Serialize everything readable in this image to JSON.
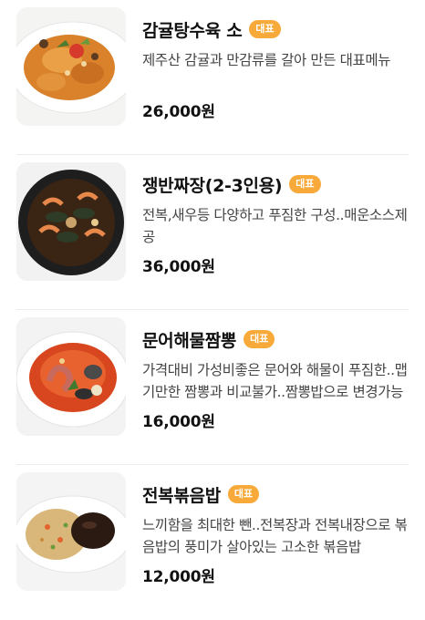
{
  "menu_items": [
    {
      "name": "감귤탕수육 소",
      "badge": "대표",
      "description": "제주산 감귤과 만감류를 갈아 만든 대표메뉴",
      "price": "26,000원",
      "image": "tangsuyuk-photo"
    },
    {
      "name": "쟁반짜장(2-3인용)",
      "badge": "대표",
      "description": "전복,새우등 다양하고 푸짐한 구성..매운소스제공",
      "price": "36,000원",
      "image": "jjajang-photo"
    },
    {
      "name": "문어해물짬뽕",
      "badge": "대표",
      "description": "가격대비 가성비좋은 문어와 해물이 푸짐한..맵기만한 짬뽕과 비교불가..짬뽕밥으로 변경가능",
      "price": "16,000원",
      "image": "jjamppong-photo"
    },
    {
      "name": "전복볶음밥",
      "badge": "대표",
      "description": "느끼함을 최대한 뺀..전복장과 전복내장으로 볶음밥의 풍미가 살아있는 고소한 볶음밥",
      "price": "12,000원",
      "image": "fried-rice-photo"
    }
  ]
}
